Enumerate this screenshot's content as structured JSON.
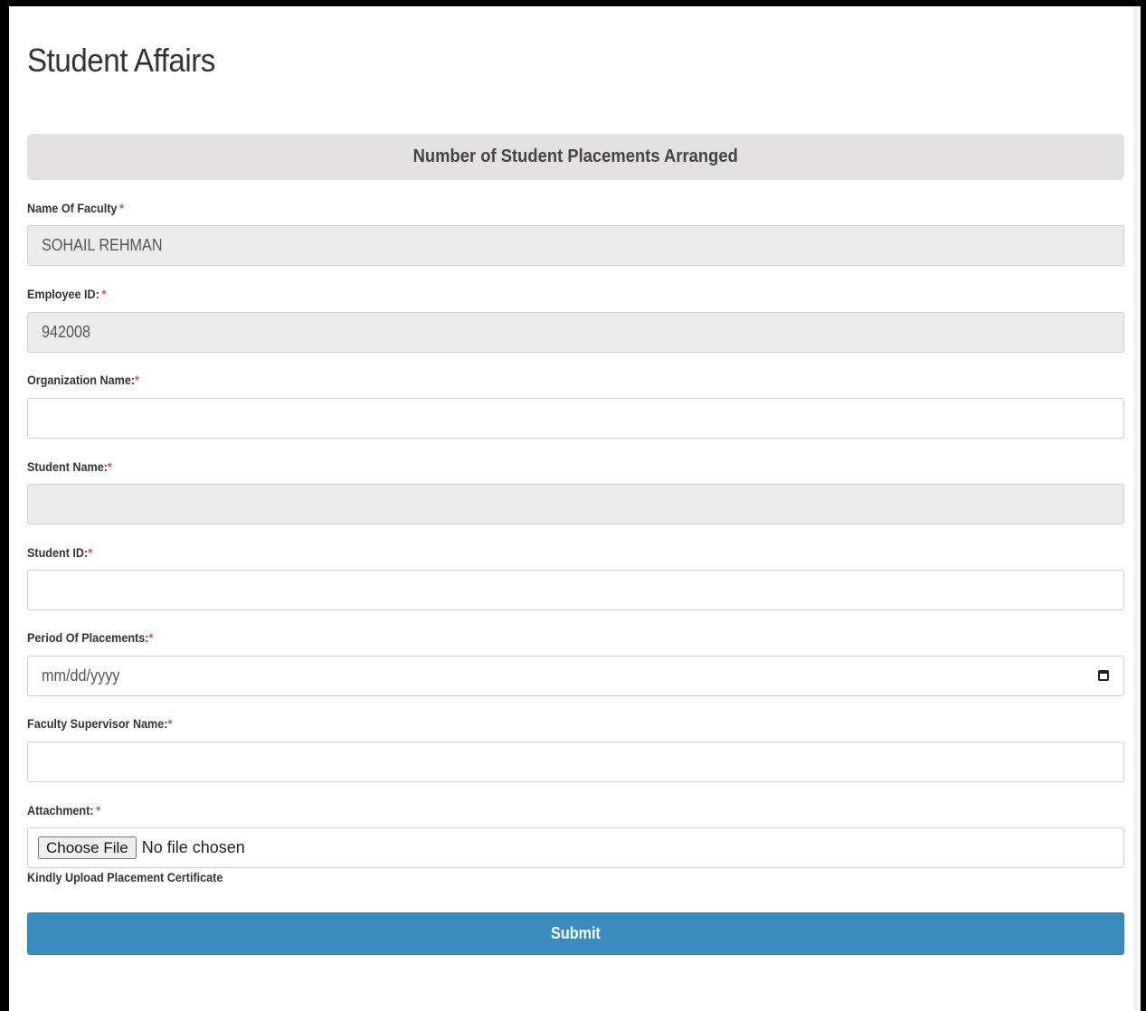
{
  "page": {
    "title": "Student Affairs"
  },
  "form": {
    "section_title": "Number of Student Placements Arranged",
    "required_marker": "*",
    "fields": {
      "faculty_name": {
        "label": "Name Of Faculty",
        "value": "SOHAIL REHMAN",
        "readonly": true
      },
      "employee_id": {
        "label": "Employee ID:",
        "value": "942008",
        "readonly": true
      },
      "organization_name": {
        "label": "Organization Name:",
        "value": "",
        "readonly": false
      },
      "student_name": {
        "label": "Student Name:",
        "value": "",
        "readonly": true
      },
      "student_id": {
        "label": "Student ID:",
        "value": "",
        "readonly": false
      },
      "period_of_placements": {
        "label": "Period Of Placements:",
        "placeholder": "mm/dd/yyyy",
        "icon": "calendar-icon"
      },
      "faculty_supervisor_name": {
        "label": "Faculty Supervisor Name:",
        "value": "",
        "readonly": false
      },
      "attachment": {
        "label": "Attachment:",
        "button_label": "Choose File",
        "status": "No file chosen",
        "help_text": "Kindly Upload Placement Certificate"
      }
    },
    "submit_label": "Submit"
  },
  "colors": {
    "required": "#d9534f",
    "submit_bg": "#3b8bbe",
    "section_bg": "#e3e1e2",
    "readonly_bg": "#ececec"
  }
}
